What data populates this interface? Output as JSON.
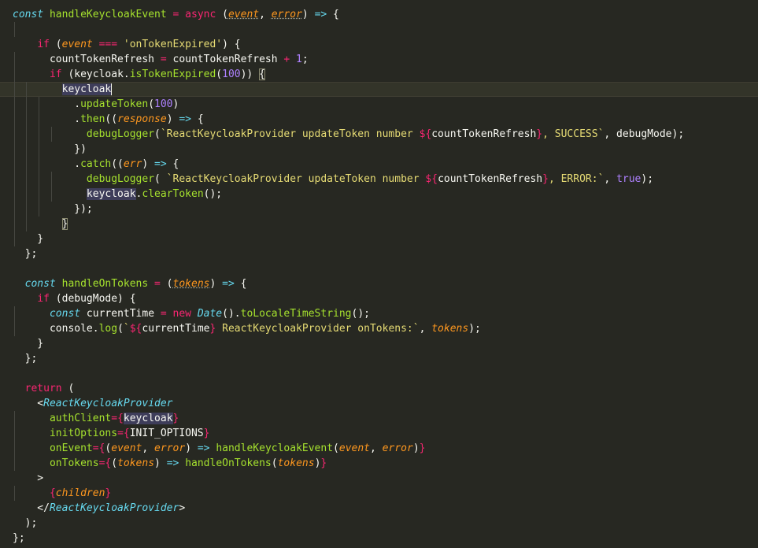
{
  "editor": {
    "theme": {
      "background": "#272822",
      "current_line": "#333429",
      "keyword": "#f92672",
      "function": "#a6e22e",
      "storage": "#66d9ef",
      "string": "#e6db74",
      "number": "#ae81ff",
      "parameter": "#fd971f",
      "text": "#f8f8f2"
    },
    "lines": [
      {
        "indent": 0,
        "guides": [],
        "tokens": [
          {
            "t": "const",
            "c": "storage"
          },
          {
            "t": " "
          },
          {
            "t": "handleKeycloakEvent",
            "c": "name"
          },
          {
            "t": " "
          },
          {
            "t": "=",
            "c": "op"
          },
          {
            "t": " "
          },
          {
            "t": "async",
            "c": "keyword"
          },
          {
            "t": " ("
          },
          {
            "t": "event",
            "c": "param",
            "d": 1
          },
          {
            "t": ", "
          },
          {
            "t": "error",
            "c": "param",
            "d": 1
          },
          {
            "t": ") "
          },
          {
            "t": "=>",
            "c": "storage"
          },
          {
            "t": " {"
          }
        ]
      },
      {
        "indent": 0,
        "guides": [
          1
        ],
        "tokens": []
      },
      {
        "indent": 0,
        "guides": [],
        "tokens": [
          {
            "t": "    "
          },
          {
            "t": "if",
            "c": "keyword"
          },
          {
            "t": " ("
          },
          {
            "t": "event",
            "c": "param"
          },
          {
            "t": " "
          },
          {
            "t": "===",
            "c": "op"
          },
          {
            "t": " "
          },
          {
            "t": "'onTokenExpired'",
            "c": "string"
          },
          {
            "t": ") {"
          }
        ]
      },
      {
        "indent": 0,
        "guides": [
          1
        ],
        "tokens": [
          {
            "t": "      countTokenRefresh "
          },
          {
            "t": "=",
            "c": "op"
          },
          {
            "t": " countTokenRefresh "
          },
          {
            "t": "+",
            "c": "op"
          },
          {
            "t": " "
          },
          {
            "t": "1",
            "c": "number"
          },
          {
            "t": ";"
          }
        ]
      },
      {
        "indent": 0,
        "guides": [
          1
        ],
        "tokens": [
          {
            "t": "      "
          },
          {
            "t": "if",
            "c": "keyword"
          },
          {
            "t": " (keycloak."
          },
          {
            "t": "isTokenExpired",
            "c": "func"
          },
          {
            "t": "("
          },
          {
            "t": "100",
            "c": "number"
          },
          {
            "t": ")) "
          },
          {
            "t": "{",
            "h": "box"
          }
        ]
      },
      {
        "indent": 0,
        "guides": [
          1,
          2
        ],
        "current": true,
        "tokens": [
          {
            "t": "        "
          },
          {
            "t": "keycloak",
            "h": "sel"
          },
          {
            "t": "",
            "cursor": true
          }
        ]
      },
      {
        "indent": 0,
        "guides": [
          1,
          2,
          3
        ],
        "tokens": [
          {
            "t": "          ."
          },
          {
            "t": "updateToken",
            "c": "func"
          },
          {
            "t": "("
          },
          {
            "t": "100",
            "c": "number"
          },
          {
            "t": ")"
          }
        ]
      },
      {
        "indent": 0,
        "guides": [
          1,
          2,
          3
        ],
        "tokens": [
          {
            "t": "          ."
          },
          {
            "t": "then",
            "c": "func"
          },
          {
            "t": "(("
          },
          {
            "t": "response",
            "c": "param"
          },
          {
            "t": ") "
          },
          {
            "t": "=>",
            "c": "storage"
          },
          {
            "t": " {"
          }
        ]
      },
      {
        "indent": 0,
        "guides": [
          1,
          2,
          3,
          4
        ],
        "tokens": [
          {
            "t": "            "
          },
          {
            "t": "debugLogger",
            "c": "func"
          },
          {
            "t": "("
          },
          {
            "t": "`ReactKeycloakProvider updateToken number ",
            "c": "string"
          },
          {
            "t": "${",
            "c": "interp"
          },
          {
            "t": "countTokenRefresh"
          },
          {
            "t": "}",
            "c": "interp"
          },
          {
            "t": ", SUCCESS`",
            "c": "string"
          },
          {
            "t": ", debugMode);"
          }
        ]
      },
      {
        "indent": 0,
        "guides": [
          1,
          2,
          3
        ],
        "tokens": [
          {
            "t": "          })"
          }
        ]
      },
      {
        "indent": 0,
        "guides": [
          1,
          2,
          3
        ],
        "tokens": [
          {
            "t": "          ."
          },
          {
            "t": "catch",
            "c": "func"
          },
          {
            "t": "(("
          },
          {
            "t": "err",
            "c": "param"
          },
          {
            "t": ") "
          },
          {
            "t": "=>",
            "c": "storage"
          },
          {
            "t": " {"
          }
        ]
      },
      {
        "indent": 0,
        "guides": [
          1,
          2,
          3,
          4
        ],
        "tokens": [
          {
            "t": "            "
          },
          {
            "t": "debugLogger",
            "c": "func"
          },
          {
            "t": "( "
          },
          {
            "t": "`ReactKeycloakProvider updateToken number ",
            "c": "string"
          },
          {
            "t": "${",
            "c": "interp"
          },
          {
            "t": "countTokenRefresh"
          },
          {
            "t": "}",
            "c": "interp"
          },
          {
            "t": ", ERROR:`",
            "c": "string"
          },
          {
            "t": ", "
          },
          {
            "t": "true",
            "c": "bool"
          },
          {
            "t": ");"
          }
        ]
      },
      {
        "indent": 0,
        "guides": [
          1,
          2,
          3,
          4
        ],
        "tokens": [
          {
            "t": "            "
          },
          {
            "t": "keycloak",
            "h": "sel"
          },
          {
            "t": "."
          },
          {
            "t": "clearToken",
            "c": "func"
          },
          {
            "t": "();"
          }
        ]
      },
      {
        "indent": 0,
        "guides": [
          1,
          2,
          3
        ],
        "tokens": [
          {
            "t": "          });"
          }
        ]
      },
      {
        "indent": 0,
        "guides": [
          1,
          2
        ],
        "tokens": [
          {
            "t": "        "
          },
          {
            "t": "}",
            "h": "box"
          }
        ]
      },
      {
        "indent": 0,
        "guides": [
          1
        ],
        "tokens": [
          {
            "t": "    }"
          }
        ]
      },
      {
        "indent": 0,
        "guides": [],
        "tokens": [
          {
            "t": "  };"
          }
        ]
      },
      {
        "indent": 0,
        "guides": [],
        "tokens": []
      },
      {
        "indent": 0,
        "guides": [],
        "tokens": [
          {
            "t": "  "
          },
          {
            "t": "const",
            "c": "storage"
          },
          {
            "t": " "
          },
          {
            "t": "handleOnTokens",
            "c": "name"
          },
          {
            "t": " "
          },
          {
            "t": "=",
            "c": "op"
          },
          {
            "t": " ("
          },
          {
            "t": "tokens",
            "c": "param",
            "d": 1
          },
          {
            "t": ") "
          },
          {
            "t": "=>",
            "c": "storage"
          },
          {
            "t": " {"
          }
        ]
      },
      {
        "indent": 0,
        "guides": [],
        "tokens": [
          {
            "t": "    "
          },
          {
            "t": "if",
            "c": "keyword"
          },
          {
            "t": " (debugMode) {"
          }
        ]
      },
      {
        "indent": 0,
        "guides": [
          1
        ],
        "tokens": [
          {
            "t": "      "
          },
          {
            "t": "const",
            "c": "storage"
          },
          {
            "t": " currentTime "
          },
          {
            "t": "=",
            "c": "op"
          },
          {
            "t": " "
          },
          {
            "t": "new",
            "c": "keyword"
          },
          {
            "t": " "
          },
          {
            "t": "Date",
            "c": "class"
          },
          {
            "t": "()."
          },
          {
            "t": "toLocaleTimeString",
            "c": "func"
          },
          {
            "t": "();"
          }
        ]
      },
      {
        "indent": 0,
        "guides": [
          1
        ],
        "tokens": [
          {
            "t": "      console."
          },
          {
            "t": "log",
            "c": "func"
          },
          {
            "t": "("
          },
          {
            "t": "`",
            "c": "string"
          },
          {
            "t": "${",
            "c": "interp"
          },
          {
            "t": "currentTime"
          },
          {
            "t": "}",
            "c": "interp"
          },
          {
            "t": " ReactKeycloakProvider onTokens:`",
            "c": "string"
          },
          {
            "t": ", "
          },
          {
            "t": "tokens",
            "c": "param"
          },
          {
            "t": ");"
          }
        ]
      },
      {
        "indent": 0,
        "guides": [],
        "tokens": [
          {
            "t": "    }"
          }
        ]
      },
      {
        "indent": 0,
        "guides": [],
        "tokens": [
          {
            "t": "  };"
          }
        ]
      },
      {
        "indent": 0,
        "guides": [],
        "tokens": []
      },
      {
        "indent": 0,
        "guides": [],
        "tokens": [
          {
            "t": "  "
          },
          {
            "t": "return",
            "c": "keyword"
          },
          {
            "t": " ("
          }
        ]
      },
      {
        "indent": 0,
        "guides": [],
        "tokens": [
          {
            "t": "    <"
          },
          {
            "t": "ReactKeycloakProvider",
            "c": "class"
          }
        ]
      },
      {
        "indent": 0,
        "guides": [
          1
        ],
        "tokens": [
          {
            "t": "      "
          },
          {
            "t": "authClient",
            "c": "attr"
          },
          {
            "t": "=",
            "c": "op"
          },
          {
            "t": "{",
            "c": "op"
          },
          {
            "t": "keycloak",
            "h": "sel"
          },
          {
            "t": "}",
            "c": "op"
          }
        ]
      },
      {
        "indent": 0,
        "guides": [
          1
        ],
        "tokens": [
          {
            "t": "      "
          },
          {
            "t": "initOptions",
            "c": "attr"
          },
          {
            "t": "=",
            "c": "op"
          },
          {
            "t": "{",
            "c": "op"
          },
          {
            "t": "INIT_OPTIONS"
          },
          {
            "t": "}",
            "c": "op"
          }
        ]
      },
      {
        "indent": 0,
        "guides": [
          1
        ],
        "tokens": [
          {
            "t": "      "
          },
          {
            "t": "onEvent",
            "c": "attr"
          },
          {
            "t": "=",
            "c": "op"
          },
          {
            "t": "{",
            "c": "op"
          },
          {
            "t": "("
          },
          {
            "t": "event",
            "c": "param"
          },
          {
            "t": ", "
          },
          {
            "t": "error",
            "c": "param"
          },
          {
            "t": ") "
          },
          {
            "t": "=>",
            "c": "storage"
          },
          {
            "t": " "
          },
          {
            "t": "handleKeycloakEvent",
            "c": "func"
          },
          {
            "t": "("
          },
          {
            "t": "event",
            "c": "param"
          },
          {
            "t": ", "
          },
          {
            "t": "error",
            "c": "param"
          },
          {
            "t": ")"
          },
          {
            "t": "}",
            "c": "op"
          }
        ]
      },
      {
        "indent": 0,
        "guides": [
          1
        ],
        "tokens": [
          {
            "t": "      "
          },
          {
            "t": "onTokens",
            "c": "attr"
          },
          {
            "t": "=",
            "c": "op"
          },
          {
            "t": "{",
            "c": "op"
          },
          {
            "t": "("
          },
          {
            "t": "tokens",
            "c": "param"
          },
          {
            "t": ") "
          },
          {
            "t": "=>",
            "c": "storage"
          },
          {
            "t": " "
          },
          {
            "t": "handleOnTokens",
            "c": "func"
          },
          {
            "t": "("
          },
          {
            "t": "tokens",
            "c": "param"
          },
          {
            "t": ")"
          },
          {
            "t": "}",
            "c": "op"
          }
        ]
      },
      {
        "indent": 0,
        "guides": [],
        "tokens": [
          {
            "t": "    >"
          }
        ]
      },
      {
        "indent": 0,
        "guides": [
          1
        ],
        "tokens": [
          {
            "t": "      "
          },
          {
            "t": "{",
            "c": "op"
          },
          {
            "t": "children",
            "c": "param"
          },
          {
            "t": "}",
            "c": "op"
          }
        ]
      },
      {
        "indent": 0,
        "guides": [],
        "tokens": [
          {
            "t": "    </"
          },
          {
            "t": "ReactKeycloakProvider",
            "c": "class"
          },
          {
            "t": ">"
          }
        ]
      },
      {
        "indent": 0,
        "guides": [],
        "tokens": [
          {
            "t": "  );"
          }
        ]
      },
      {
        "indent": 0,
        "guides": [],
        "tokens": [
          {
            "t": "};"
          }
        ]
      }
    ]
  }
}
